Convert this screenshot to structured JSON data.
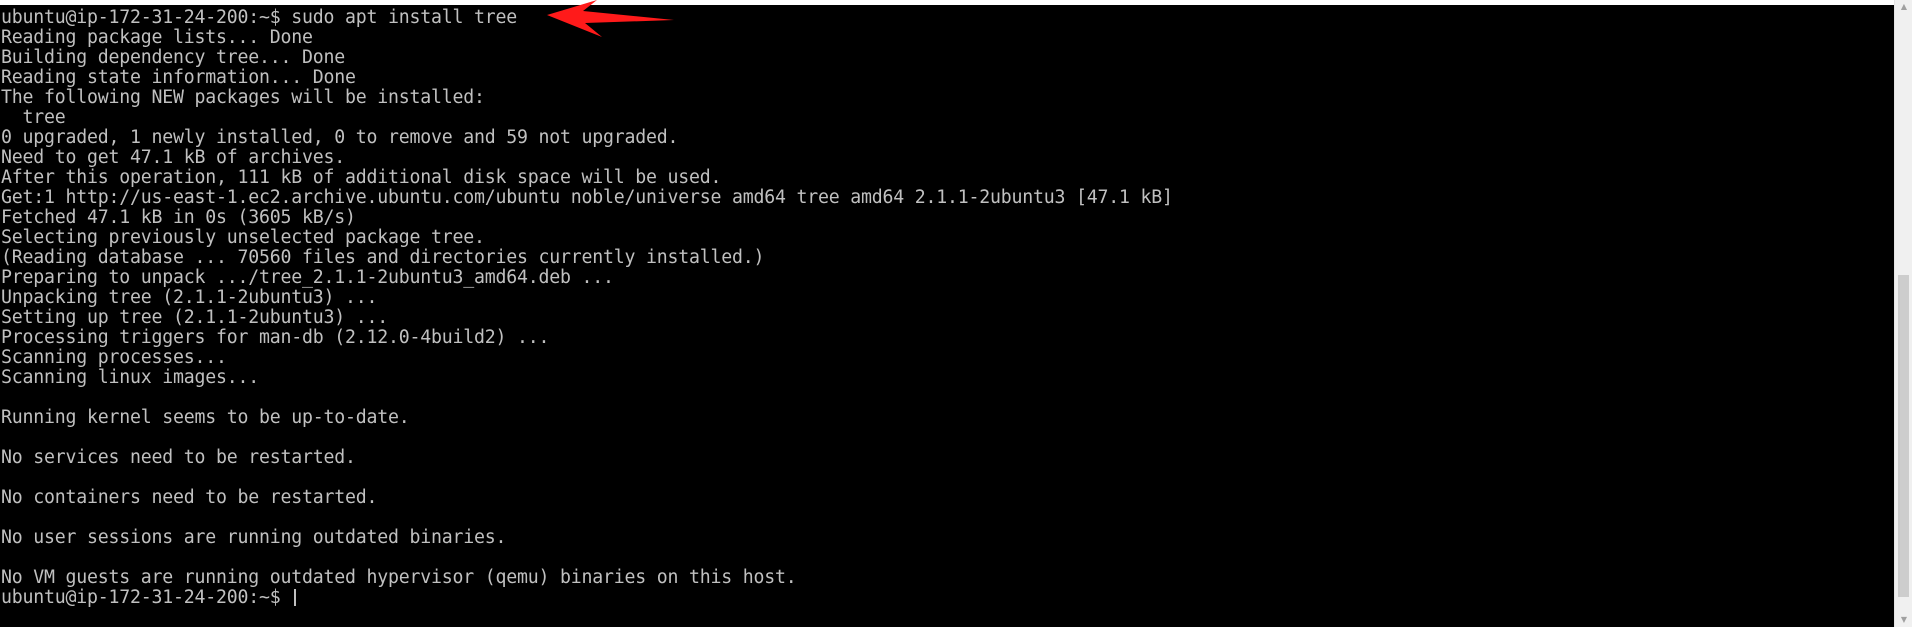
{
  "terminal": {
    "prompt": "ubuntu@ip-172-31-24-200:~$",
    "lines": [
      "ubuntu@ip-172-31-24-200:~$ sudo apt install tree",
      "Reading package lists... Done",
      "Building dependency tree... Done",
      "Reading state information... Done",
      "The following NEW packages will be installed:",
      "  tree",
      "0 upgraded, 1 newly installed, 0 to remove and 59 not upgraded.",
      "Need to get 47.1 kB of archives.",
      "After this operation, 111 kB of additional disk space will be used.",
      "Get:1 http://us-east-1.ec2.archive.ubuntu.com/ubuntu noble/universe amd64 tree amd64 2.1.1-2ubuntu3 [47.1 kB]",
      "Fetched 47.1 kB in 0s (3605 kB/s)",
      "Selecting previously unselected package tree.",
      "(Reading database ... 70560 files and directories currently installed.)",
      "Preparing to unpack .../tree_2.1.1-2ubuntu3_amd64.deb ...",
      "Unpacking tree (2.1.1-2ubuntu3) ...",
      "Setting up tree (2.1.1-2ubuntu3) ...",
      "Processing triggers for man-db (2.12.0-4build2) ...",
      "Scanning processes...",
      "Scanning linux images...",
      "",
      "Running kernel seems to be up-to-date.",
      "",
      "No services need to be restarted.",
      "",
      "No containers need to be restarted.",
      "",
      "No user sessions are running outdated binaries.",
      "",
      "No VM guests are running outdated hypervisor (qemu) binaries on this host."
    ]
  },
  "scrollbar": {
    "up_arrow": "▲",
    "down_arrow": "▼"
  },
  "colors": {
    "background": "#000000",
    "foreground": "#c0c0c0",
    "annotation_arrow": "#ff1a1a"
  },
  "annotation": {
    "icon": "red-arrow-icon"
  }
}
